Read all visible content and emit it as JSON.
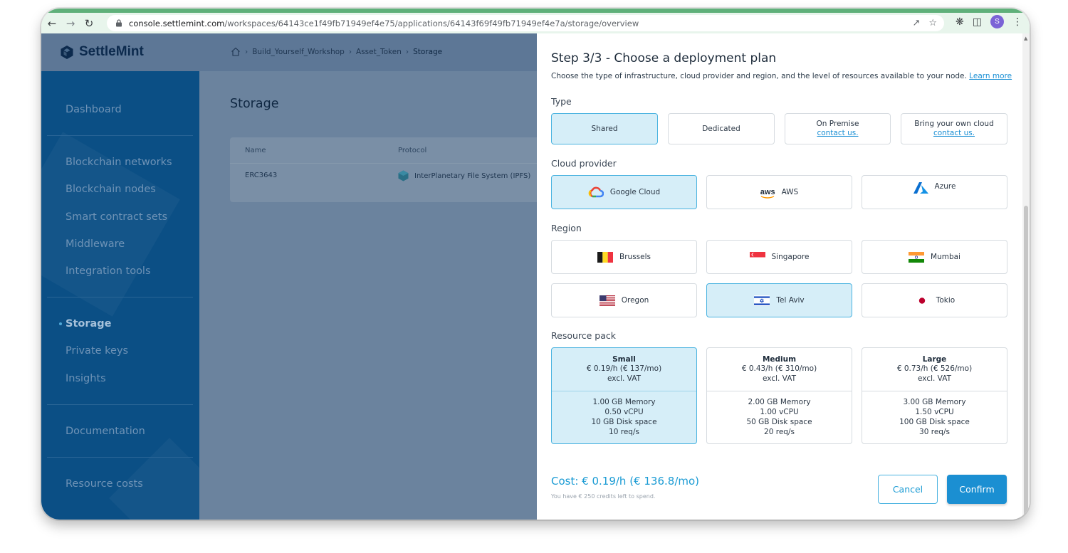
{
  "browser": {
    "url_host": "console.settlemint.com",
    "url_path": "/workspaces/64143ce1f49fb71949ef4e75/applications/64143f69f49fb71949ef4e7a/storage/overview",
    "profile_initial": "S"
  },
  "app": {
    "logo": "SettleMint",
    "breadcrumb": [
      "Build_Yourself_Workshop",
      "Asset_Token",
      "Storage"
    ]
  },
  "sidebar": {
    "items": [
      {
        "label": "Dashboard"
      },
      {
        "label": "Blockchain networks"
      },
      {
        "label": "Blockchain nodes"
      },
      {
        "label": "Smart contract sets"
      },
      {
        "label": "Middleware"
      },
      {
        "label": "Integration tools"
      },
      {
        "label": "Storage",
        "active": true
      },
      {
        "label": "Private keys"
      },
      {
        "label": "Insights"
      },
      {
        "label": "Documentation"
      },
      {
        "label": "Resource costs"
      }
    ]
  },
  "main": {
    "title": "Storage",
    "table": {
      "headers": [
        "Name",
        "Protocol"
      ],
      "rows": [
        [
          "ERC3643",
          "InterPlanetary File System (IPFS)"
        ]
      ]
    }
  },
  "panel": {
    "title": "Step 3/3 - Choose a deployment plan",
    "subtitle": "Choose the type of infrastructure, cloud provider and region, and the level of resources available to your node.",
    "learn_more": "Learn more",
    "type_label": "Type",
    "types": [
      {
        "label": "Shared",
        "selected": true
      },
      {
        "label": "Dedicated"
      },
      {
        "label": "On Premise",
        "link": "contact us."
      },
      {
        "label": "Bring your own cloud",
        "link": "contact us."
      }
    ],
    "provider_label": "Cloud provider",
    "providers": [
      {
        "label": "Google Cloud",
        "icon": "google-cloud-icon",
        "selected": true
      },
      {
        "label": "AWS",
        "icon": "aws-icon",
        "icon_text": "aws"
      },
      {
        "label": "Azure",
        "icon": "azure-icon"
      }
    ],
    "region_label": "Region",
    "regions": [
      {
        "label": "Brussels",
        "flag": "belgium-flag-icon"
      },
      {
        "label": "Singapore",
        "flag": "singapore-flag-icon"
      },
      {
        "label": "Mumbai",
        "flag": "india-flag-icon"
      },
      {
        "label": "Oregon",
        "flag": "usa-flag-icon"
      },
      {
        "label": "Tel Aviv",
        "flag": "israel-flag-icon",
        "selected": true
      },
      {
        "label": "Tokio",
        "flag": "japan-flag-icon"
      }
    ],
    "pack_label": "Resource pack",
    "packs": [
      {
        "name": "Small",
        "price": "€ 0.19/h (€ 137/mo)",
        "vat": "excl. VAT",
        "memory": "1.00 GB Memory",
        "cpu": "0.50 vCPU",
        "disk": "10 GB Disk space",
        "req": "10 req/s",
        "selected": true
      },
      {
        "name": "Medium",
        "price": "€ 0.43/h (€ 310/mo)",
        "vat": "excl. VAT",
        "memory": "2.00 GB Memory",
        "cpu": "1.00 vCPU",
        "disk": "50 GB Disk space",
        "req": "20 req/s"
      },
      {
        "name": "Large",
        "price": "€ 0.73/h (€ 526/mo)",
        "vat": "excl. VAT",
        "memory": "3.00 GB Memory",
        "cpu": "1.50 vCPU",
        "disk": "100 GB Disk space",
        "req": "30 req/s"
      }
    ],
    "cost": "Cost: € 0.19/h (€ 136.8/mo)",
    "credits": "You have € 250 credits left to spend.",
    "cancel": "Cancel",
    "confirm": "Confirm"
  },
  "colors": {
    "accent": "#1b8fd2",
    "selected_bg": "#d6eef8",
    "sidebar_bg": "#0b4f85"
  }
}
